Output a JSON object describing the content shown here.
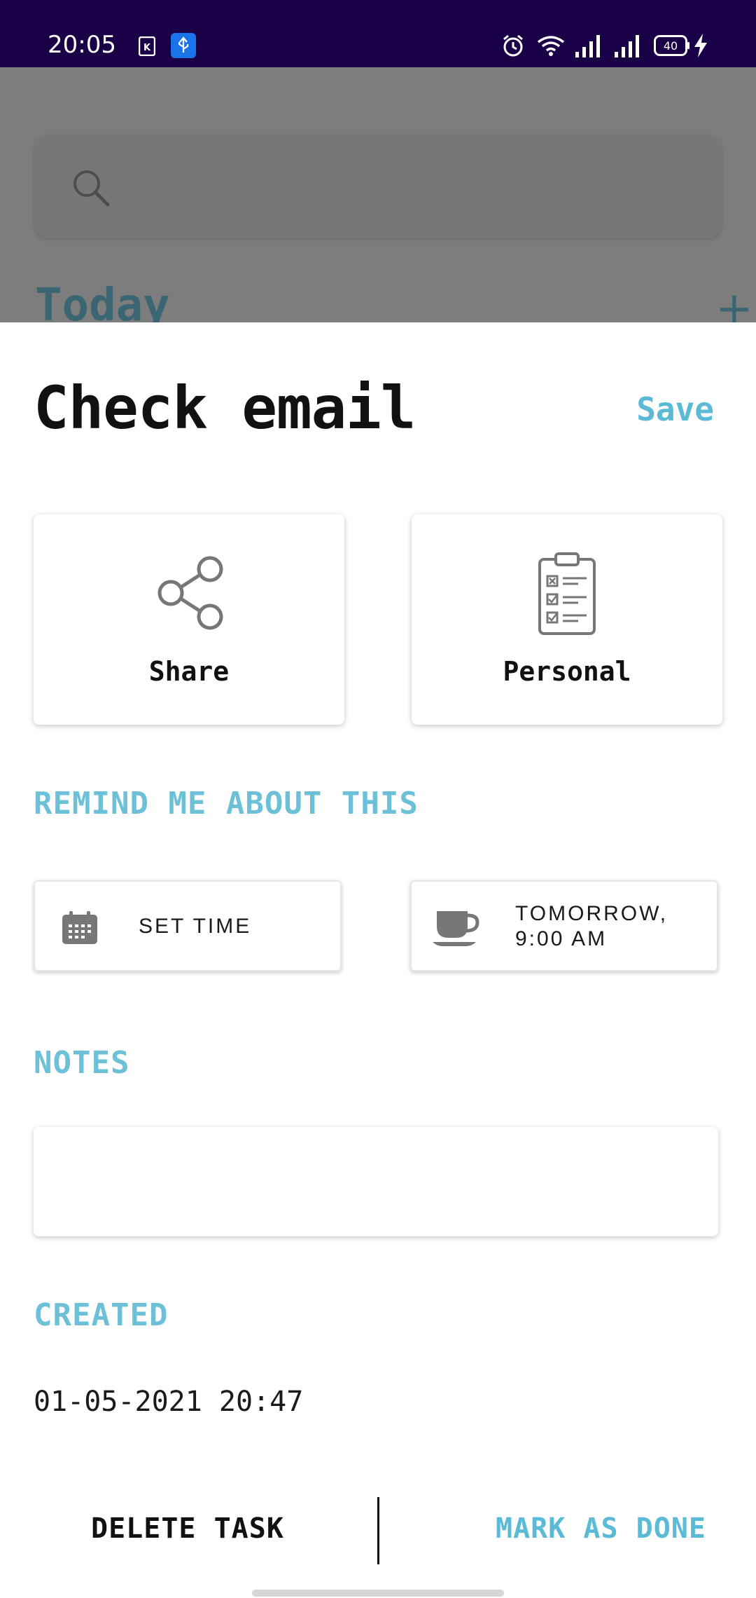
{
  "status_bar": {
    "time": "20:05",
    "battery": "40",
    "icons": [
      "kindle-icon",
      "usb-icon",
      "alarm-icon",
      "wifi-icon",
      "signal-icon",
      "signal-icon",
      "battery-icon",
      "charging-icon"
    ]
  },
  "background": {
    "section_title": "Today",
    "add_symbol": "+"
  },
  "task": {
    "title": "Check email",
    "save_label": "Save"
  },
  "cards": {
    "share": {
      "label": "Share",
      "icon": "share-icon"
    },
    "list": {
      "label": "Personal",
      "icon": "clipboard-checklist-icon"
    }
  },
  "reminder": {
    "heading": "REMIND ME ABOUT THIS",
    "set_time_label": "SET TIME",
    "set_time_icon": "calendar-icon",
    "preset_label_line1": "TOMORROW,",
    "preset_label_line2": "9:00 AM",
    "preset_icon": "coffee-cup-icon"
  },
  "notes": {
    "heading": "NOTES",
    "value": ""
  },
  "created": {
    "heading": "CREATED",
    "value": "01-05-2021 20:47"
  },
  "footer": {
    "delete_label": "DELETE TASK",
    "done_label": "MARK AS DONE"
  },
  "colors": {
    "status_bar": "#1a0047",
    "accent": "#5bbad5",
    "text": "#111111",
    "scrim": "#7d7d7d"
  }
}
